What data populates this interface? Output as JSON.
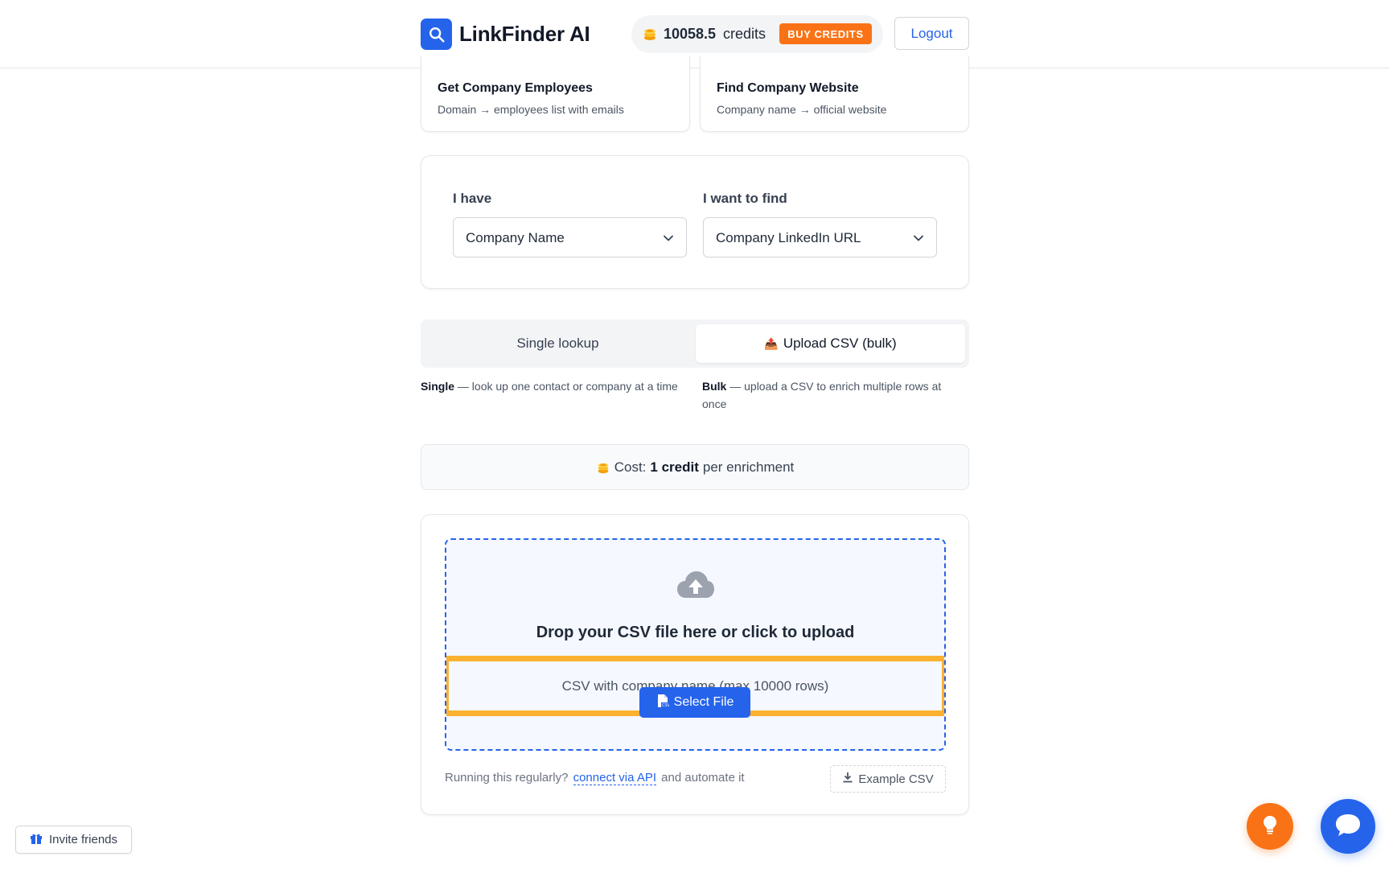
{
  "header": {
    "app_name": "LinkFinder AI",
    "credits_amount": "10058.5",
    "credits_label": "credits",
    "buy_credits": "BUY CREDITS",
    "logout": "Logout"
  },
  "tools": [
    {
      "title": "Get Company Employees",
      "desc": "Domain → employees list with emails"
    },
    {
      "title": "Find Company Website",
      "desc": "Company name → official website"
    }
  ],
  "selector": {
    "have_label": "I have",
    "have_value": "Company Name",
    "find_label": "I want to find",
    "find_value": "Company LinkedIn URL"
  },
  "tabs": {
    "single": "Single lookup",
    "bulk": "Upload CSV (bulk)",
    "bulk_icon": "📤"
  },
  "descriptions": {
    "single_bold": "Single",
    "single_text": " — look up one contact or company at a time",
    "bulk_bold": "Bulk",
    "bulk_text": " — upload a CSV to enrich multiple rows at once"
  },
  "cost": {
    "prefix": "Cost:",
    "amount": "1 credit",
    "suffix": "per enrichment"
  },
  "upload": {
    "drop_title": "Drop your CSV file here or click to upload",
    "hint": "CSV with company name (max 10000 rows)",
    "select_file": "Select File",
    "footer_prefix": "Running this regularly?",
    "api_link": "connect via API",
    "footer_suffix": "and automate it",
    "example_csv": "Example CSV"
  },
  "invite": "Invite friends",
  "colors": {
    "primary": "#2563eb",
    "accent": "#f97316",
    "highlight": "#fbb130"
  }
}
